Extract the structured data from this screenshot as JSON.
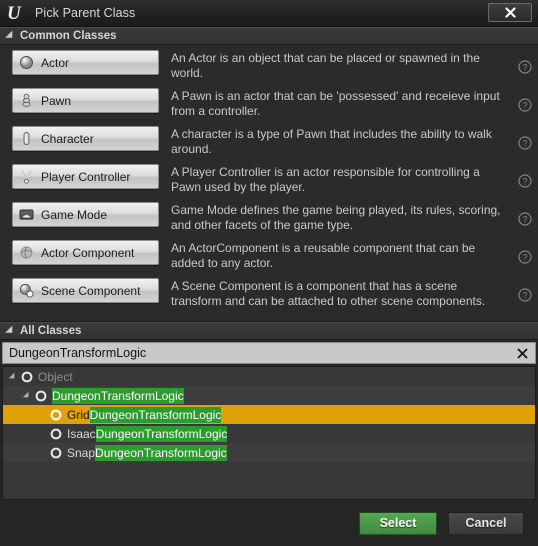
{
  "window": {
    "title": "Pick Parent Class",
    "logo_icon": "unreal-engine-logo",
    "close_icon": "close-icon"
  },
  "common_section": {
    "header_label": "Common Classes",
    "expander_icon": "chevron-down-icon",
    "help_icon": "help-circle-icon",
    "classes": [
      {
        "name": "Actor",
        "icon": "actor-sphere-icon",
        "description": "An Actor is an object that can be placed or spawned in the world."
      },
      {
        "name": "Pawn",
        "icon": "pawn-icon",
        "description": "A Pawn is an actor that can be 'possessed' and receieve input from a controller."
      },
      {
        "name": "Character",
        "icon": "character-capsule-icon",
        "description": "A character is a type of Pawn that includes the ability to walk around."
      },
      {
        "name": "Player Controller",
        "icon": "player-controller-icon",
        "description": "A Player Controller is an actor responsible for controlling a Pawn used by the player."
      },
      {
        "name": "Game Mode",
        "icon": "game-mode-icon",
        "description": "Game Mode defines the game being played, its rules, scoring, and other facets of the game type."
      },
      {
        "name": "Actor Component",
        "icon": "actor-component-icon",
        "description": "An ActorComponent is a reusable component that can be added to any actor."
      },
      {
        "name": "Scene Component",
        "icon": "scene-component-icon",
        "description": "A Scene Component is a component that has a scene transform and can be attached to other scene components."
      }
    ]
  },
  "all_section": {
    "header_label": "All Classes",
    "expander_icon": "chevron-down-icon",
    "search": {
      "value": "DungeonTransformLogic",
      "placeholder": "Search Classes",
      "clear_icon": "clear-x-icon"
    },
    "tree": [
      {
        "prefix": "Object",
        "match": "",
        "indent": 0,
        "expandable": true,
        "dim": true,
        "selected": false,
        "icon": "class-circle-icon"
      },
      {
        "prefix": "",
        "match": "DungeonTransformLogic",
        "indent": 1,
        "expandable": true,
        "dim": false,
        "selected": false,
        "icon": "class-circle-icon"
      },
      {
        "prefix": "Grid",
        "match": "DungeonTransformLogic",
        "indent": 2,
        "expandable": false,
        "dim": false,
        "selected": true,
        "icon": "class-circle-icon"
      },
      {
        "prefix": "Isaac",
        "match": "DungeonTransformLogic",
        "indent": 2,
        "expandable": false,
        "dim": false,
        "selected": false,
        "icon": "class-circle-icon"
      },
      {
        "prefix": "Snap",
        "match": "DungeonTransformLogic",
        "indent": 2,
        "expandable": false,
        "dim": false,
        "selected": false,
        "icon": "class-circle-icon"
      }
    ]
  },
  "footer": {
    "select_label": "Select",
    "cancel_label": "Cancel"
  },
  "colors": {
    "selection": "#e0a007",
    "match_highlight": "#2e9b2e",
    "select_button": "#4a9a48",
    "window_bg": "#262626"
  }
}
